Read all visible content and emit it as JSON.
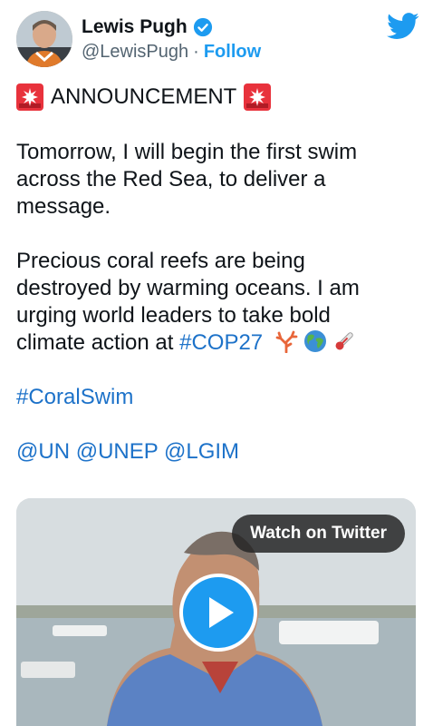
{
  "author": {
    "name": "Lewis Pugh",
    "handle": "@LewisPugh",
    "separator": "·",
    "follow_label": "Follow"
  },
  "tweet": {
    "announcement": "ANNOUNCEMENT",
    "para1": [
      "Tomorrow, I will begin the first swim",
      "across the Red Sea, to deliver a",
      "message."
    ],
    "para2": [
      "Precious coral reefs are being",
      "destroyed by warming oceans. I am",
      "urging world leaders to take bold"
    ],
    "para2_last_text": "climate action at ",
    "hashtag_cop": "#COP27",
    "hashtag_coral": "#CoralSwim",
    "mentions": [
      "@UN",
      "@UNEP",
      "@LGIM"
    ]
  },
  "media": {
    "watch_label": "Watch on Twitter"
  },
  "icons": {
    "verified": "verified-badge-icon",
    "twitter": "twitter-bird-icon",
    "siren": "rotating-light-icon",
    "coral": "coral-icon",
    "globe": "globe-icon",
    "thermometer": "thermometer-icon",
    "play": "play-icon"
  },
  "colors": {
    "accent": "#1d9bf0",
    "link": "#1d72c9",
    "text": "#0f1419",
    "muted": "#536471"
  }
}
